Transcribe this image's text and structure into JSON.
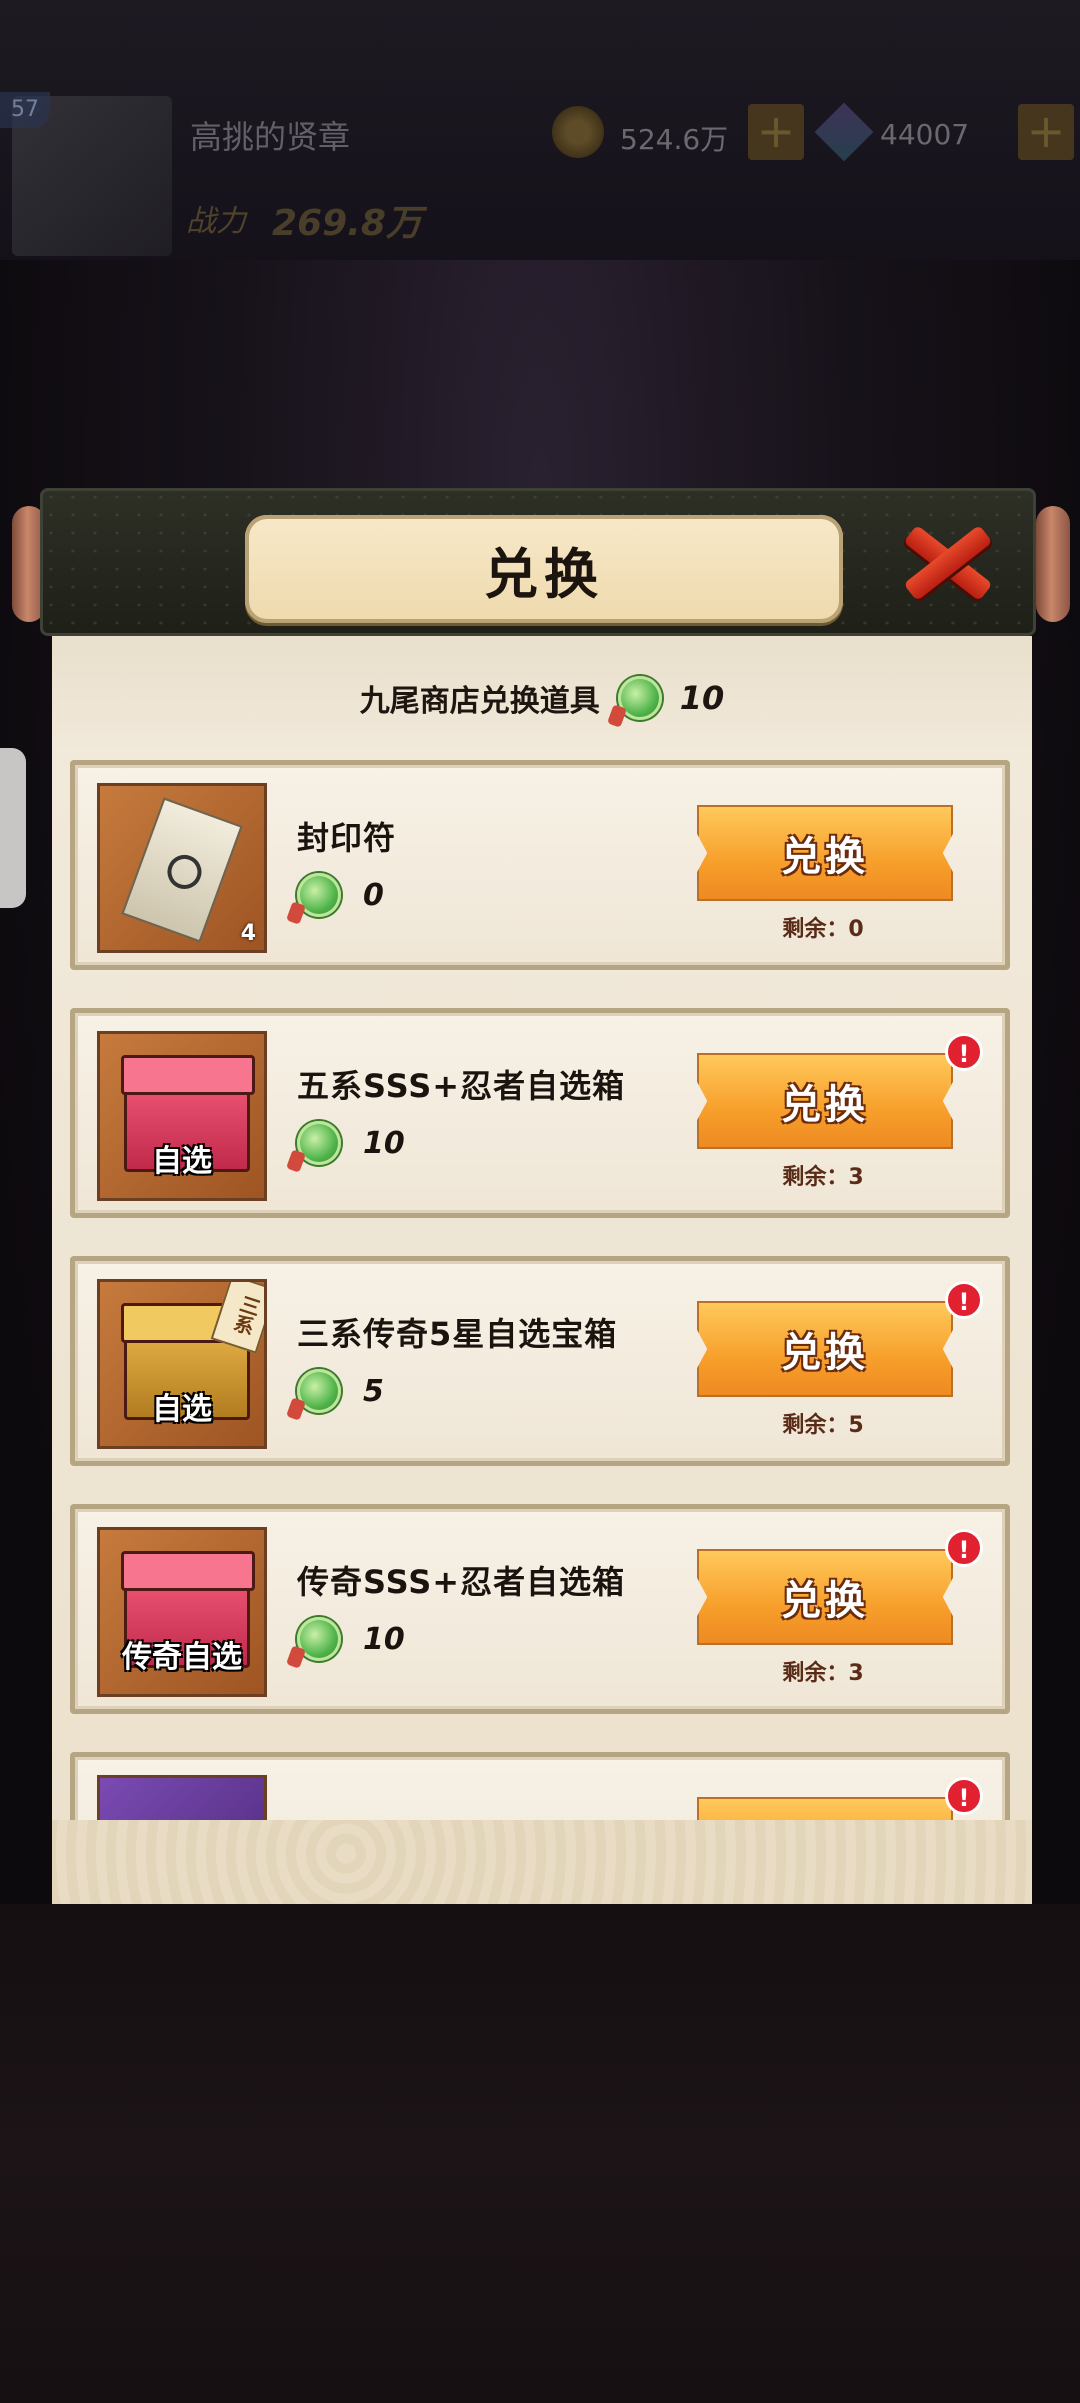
{
  "hud": {
    "level": "57",
    "player_name": "高挑的贤章",
    "power_label": "战力",
    "power_value": "269.8万",
    "coins": "524.6万",
    "gems": "44007",
    "plus": "+"
  },
  "dialog": {
    "title": "兑换",
    "currency_label": "九尾商店兑换道具",
    "currency_amount": "10",
    "exchange_label": "兑换",
    "remaining_prefix": "剩余："
  },
  "items": [
    {
      "name": "封印符",
      "cost": "0",
      "remaining": "剩余：0",
      "thumb_count": "4",
      "alert": false
    },
    {
      "name": "五系SSS+忍者自选箱",
      "cost": "10",
      "remaining": "剩余：3",
      "thumb_tag": "自选",
      "alert": true
    },
    {
      "name": "三系传奇5星自选宝箱",
      "cost": "5",
      "remaining": "剩余：5",
      "thumb_tag": "自选",
      "corner_tag": "三系",
      "alert": true
    },
    {
      "name": "传奇SSS+忍者自选箱",
      "cost": "10",
      "remaining": "剩余：3",
      "thumb_tag": "传奇自选",
      "alert": true
    },
    {
      "name": "",
      "alert": true
    }
  ],
  "alert_glyph": "!",
  "colors": {
    "button": "#f79f2b",
    "alert": "#e12030",
    "close": "#e84a2b",
    "panel": "#f2eadc"
  },
  "icons": {
    "currency": "jade-token-icon",
    "close": "close-x-icon"
  }
}
